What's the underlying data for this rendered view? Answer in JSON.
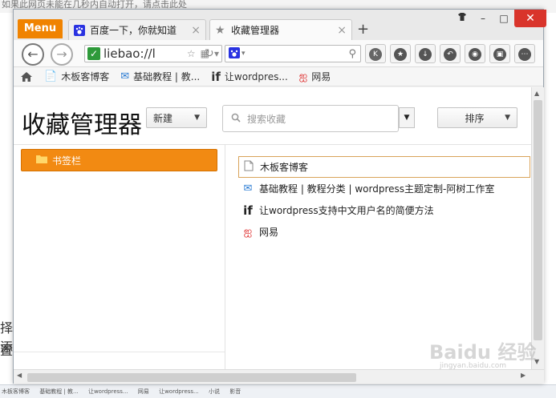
{
  "background": {
    "top_text": "如果此网页未能在几秒内自动打开，请点击此处",
    "side_text_1": "择添",
    "side_text_2": "置，",
    "taskbar_items": [
      "木板客博客",
      "基础教程 | 教...",
      "让wordpress...",
      "网易",
      "让wordpress...",
      "小说",
      "影音"
    ]
  },
  "window": {
    "menu_label": "Menu",
    "tabs": [
      {
        "title": "百度一下，你就知道",
        "icon": "baidu-paw-icon",
        "close": "×"
      },
      {
        "title": "收藏管理器",
        "icon": "star-icon",
        "close": "×"
      }
    ],
    "new_tab": "+",
    "controls": {
      "minimize": "–",
      "maximize": "□",
      "close": "✕",
      "skin": "👕"
    }
  },
  "navbar": {
    "back": "←",
    "forward": "→",
    "url": "liebao://l",
    "refresh": "↻",
    "search_engine_icon": "baidu-paw-icon",
    "toolbar": [
      "k-icon",
      "star-icon",
      "download-icon",
      "undo-icon",
      "gamepad-icon",
      "screen-icon",
      "more-icon"
    ]
  },
  "bookmarks_bar": {
    "items": [
      {
        "label": "",
        "icon": "home-icon"
      },
      {
        "label": "木板客博客",
        "icon": "page-icon"
      },
      {
        "label": "基础教程 | 教...",
        "icon": "mail-icon"
      },
      {
        "label": "让wordpres...",
        "icon": "if-icon"
      },
      {
        "label": "网易",
        "icon": "netease-icon"
      }
    ]
  },
  "manager": {
    "title": "收藏管理器",
    "new_button": "新建",
    "search_placeholder": "搜索收藏",
    "sort_button": "排序",
    "folder_label": "书签栏",
    "bookmarks": [
      {
        "title": "木板客博客",
        "icon": "page-icon",
        "glyph": "📄"
      },
      {
        "title": "基础教程 | 教程分类 | wordpress主题定制-阿树工作室",
        "icon": "mail-icon",
        "glyph": "✉"
      },
      {
        "title": "让wordpress支持中文用户名的简便方法",
        "icon": "if-icon",
        "glyph": "if"
      },
      {
        "title": "网易",
        "icon": "netease-icon",
        "glyph": "ஐ"
      }
    ]
  },
  "watermark": {
    "text": "Baidu 经验",
    "url": "jingyan.baidu.com"
  },
  "colors": {
    "accent": "#f08300",
    "folder": "#f28a12",
    "close": "#d9342b"
  }
}
